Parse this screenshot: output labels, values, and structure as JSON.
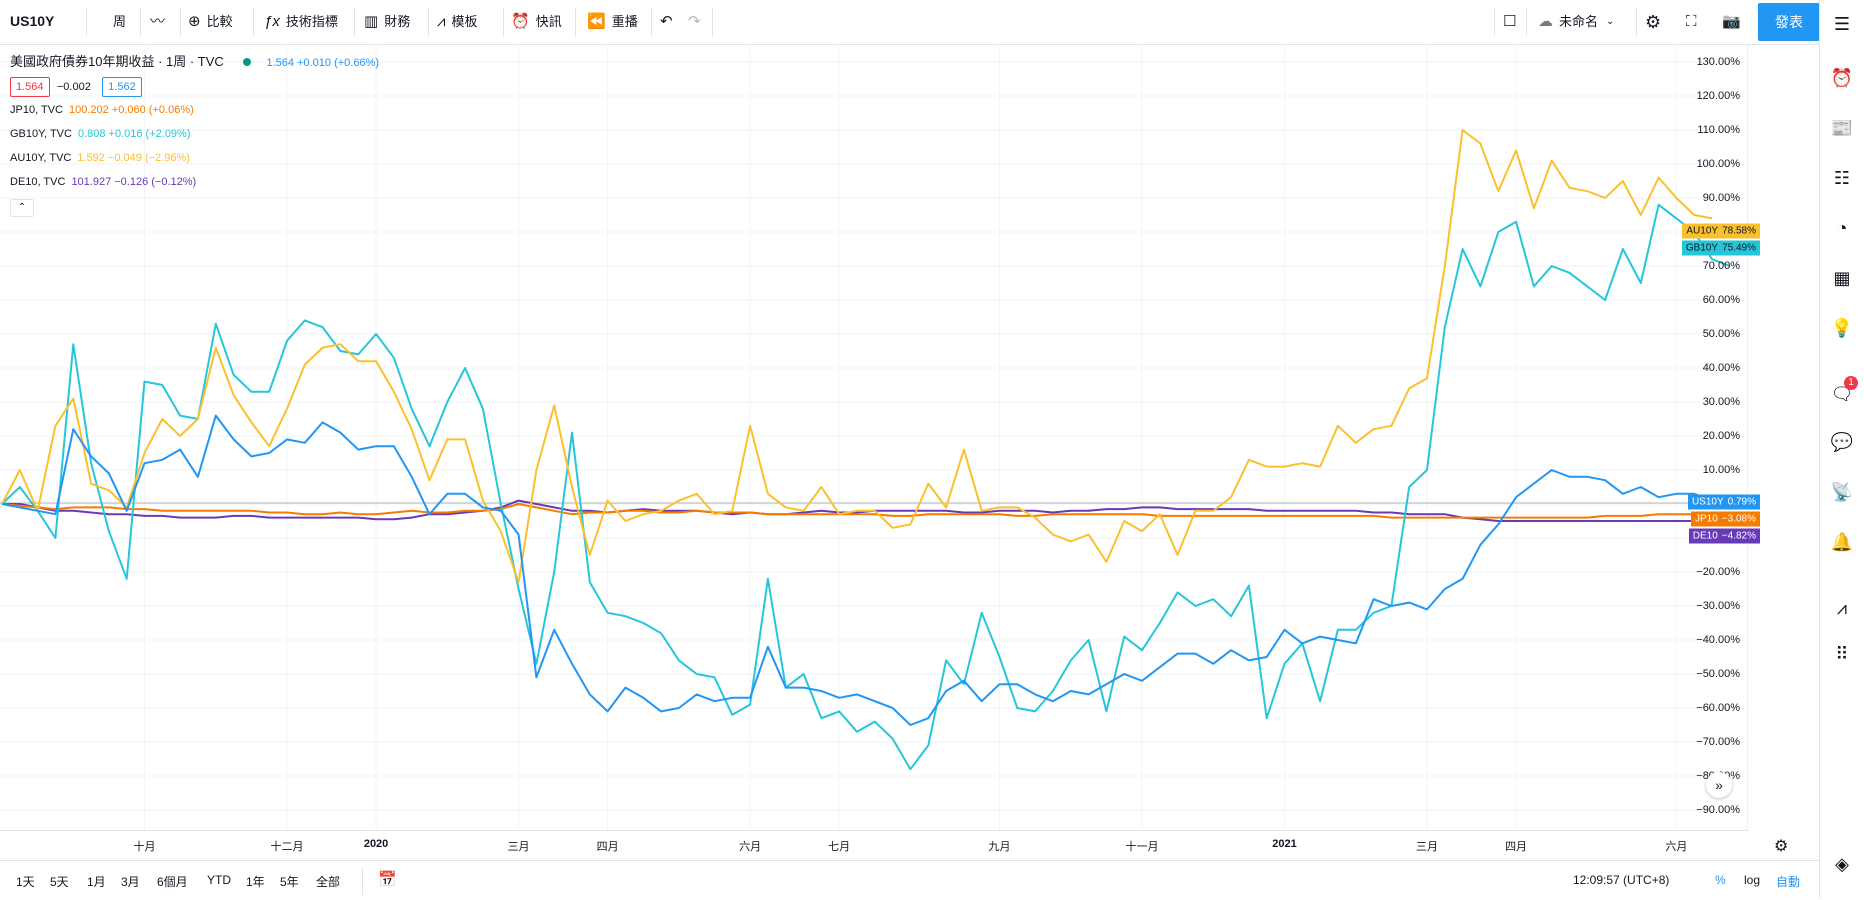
{
  "toolbar": {
    "symbol": "US10Y",
    "interval": "周",
    "compare": "比較",
    "indicators": "技術指標",
    "financials": "財務",
    "templates": "模板",
    "alert": "快訊",
    "replay": "重播",
    "layout_name": "未命名",
    "publish": "發表"
  },
  "legend": {
    "main_title": "美國政府債券10年期收益 · 1周 · TVC",
    "main_value": "1.564 +0.010 (+0.66%)",
    "bid": "1.564",
    "spread": "−0.002",
    "ask": "1.562",
    "items": [
      {
        "name": "JP10, TVC",
        "value": "100.202 +0.060 (+0.06%)",
        "color": "#f57c00"
      },
      {
        "name": "GB10Y, TVC",
        "value": "0.808 +0.016 (+2.09%)",
        "color": "#26c6da"
      },
      {
        "name": "AU10Y, TVC",
        "value": "1.592 −0.049 (−2.96%)",
        "color": "#fbc02d"
      },
      {
        "name": "DE10, TVC",
        "value": "101.927 −0.126 (−0.12%)",
        "color": "#673ab7"
      }
    ]
  },
  "colors": {
    "us10y": "#2196f3",
    "jp10": "#f57c00",
    "gb10y": "#26c6da",
    "au10y": "#fbc02d",
    "de10": "#673ab7"
  },
  "chart_data": {
    "type": "line",
    "y_axis_unit": "percent change",
    "ylim": [
      -95,
      135
    ],
    "y_ticks": [
      "130.00%",
      "120.00%",
      "110.00%",
      "100.00%",
      "90.00%",
      "80.00%",
      "70.00%",
      "60.00%",
      "50.00%",
      "40.00%",
      "30.00%",
      "20.00%",
      "10.00%",
      "0.00%",
      "−10.00%",
      "−20.00%",
      "−30.00%",
      "−40.00%",
      "−50.00%",
      "−60.00%",
      "−70.00%",
      "−80.00%",
      "−90.00%"
    ],
    "y_tick_values": [
      130,
      120,
      110,
      100,
      90,
      80,
      70,
      60,
      50,
      40,
      30,
      20,
      10,
      0,
      -10,
      -20,
      -30,
      -40,
      -50,
      -60,
      -70,
      -80,
      -90
    ],
    "x_labels": [
      "十月",
      "十二月",
      "2020",
      "三月",
      "四月",
      "六月",
      "七月",
      "九月",
      "十一月",
      "2021",
      "三月",
      "四月",
      "六月"
    ],
    "x_label_weeks": [
      8,
      16,
      21,
      29,
      34,
      42,
      47,
      56,
      64,
      72,
      80,
      85,
      94
    ],
    "weeks": 97,
    "series": [
      {
        "name": "US10Y",
        "color": "#2196f3",
        "last_label": "0.79%",
        "values": [
          0,
          -1,
          -2,
          -3,
          22,
          14,
          9,
          -2,
          12,
          13,
          16,
          8,
          26,
          19,
          14,
          15,
          19,
          18,
          24,
          21,
          16,
          17,
          17,
          8,
          -3,
          3,
          3,
          -1,
          -2,
          -9,
          -51,
          -37,
          -47,
          -56,
          -61,
          -54,
          -57,
          -61,
          -60,
          -56,
          -58,
          -57,
          -57,
          -42,
          -54,
          -54,
          -55,
          -57,
          -56,
          -58,
          -60,
          -65,
          -63,
          -55,
          -52,
          -58,
          -53,
          -53,
          -56,
          -58,
          -55,
          -56,
          -53,
          -50,
          -52,
          -48,
          -44,
          -44,
          -47,
          -43,
          -46,
          -45,
          -37,
          -41,
          -39,
          -40,
          -41,
          -28,
          -30,
          -29,
          -31,
          -25,
          -22,
          -12,
          -6,
          2,
          6,
          10,
          8,
          8,
          7,
          3,
          5,
          2,
          3,
          3,
          1,
          2,
          1
        ]
      },
      {
        "name": "JP10",
        "color": "#f57c00",
        "last_label": "−3.08%",
        "values": [
          0,
          -0.5,
          -1,
          -1.5,
          -1,
          -1,
          -1,
          -1.5,
          -1.5,
          -2,
          -2,
          -2,
          -2,
          -2,
          -2,
          -2.5,
          -2.5,
          -3,
          -3,
          -2.5,
          -3,
          -3,
          -2.5,
          -2,
          -2.5,
          -2.5,
          -2,
          -2,
          -1.5,
          0,
          -1,
          -2,
          -3,
          -2.5,
          -2.5,
          -2,
          -2,
          -2.5,
          -2.5,
          -2,
          -2.5,
          -2.5,
          -2.5,
          -3,
          -3,
          -3,
          -3,
          -3,
          -3,
          -3,
          -3.5,
          -3.5,
          -3,
          -3,
          -3,
          -3,
          -3,
          -3.5,
          -3.5,
          -3,
          -3,
          -3,
          -3,
          -3,
          -3,
          -3.5,
          -3.5,
          -3.5,
          -3.5,
          -3.5,
          -3.5,
          -3.5,
          -3.5,
          -3.5,
          -3.5,
          -3.5,
          -3.5,
          -3.5,
          -4,
          -4,
          -4,
          -4,
          -4,
          -4,
          -4,
          -4,
          -4,
          -4,
          -4,
          -4,
          -3.5,
          -3.5,
          -3.5,
          -3,
          -3,
          -3,
          -3,
          -3
        ]
      },
      {
        "name": "GB10Y",
        "color": "#26c6da",
        "last_label": "75.49%",
        "values": [
          0,
          5,
          -2,
          -10,
          47,
          12,
          -8,
          -22,
          36,
          35,
          26,
          25,
          53,
          38,
          33,
          33,
          48,
          54,
          52,
          45,
          44,
          50,
          43,
          28,
          17,
          30,
          40,
          28,
          0,
          -25,
          -47,
          -20,
          21,
          -23,
          -32,
          -33,
          -35,
          -38,
          -46,
          -50,
          -51,
          -62,
          -59,
          -22,
          -54,
          -50,
          -63,
          -61,
          -67,
          -64,
          -69,
          -78,
          -71,
          -46,
          -53,
          -32,
          -45,
          -60,
          -61,
          -55,
          -46,
          -40,
          -61,
          -39,
          -43,
          -35,
          -26,
          -30,
          -28,
          -33,
          -24,
          -63,
          -47,
          -41,
          -58,
          -37,
          -37,
          -32,
          -30,
          5,
          10,
          52,
          75,
          64,
          80,
          83,
          64,
          70,
          68,
          64,
          60,
          75,
          65,
          88,
          84,
          80,
          72,
          70
        ]
      },
      {
        "name": "AU10Y",
        "color": "#fbc02d",
        "last_label": "78.58%",
        "values": [
          0,
          10,
          -2,
          23,
          31,
          6,
          4,
          -1,
          15,
          25,
          20,
          25,
          46,
          32,
          24,
          17,
          28,
          41,
          46,
          47,
          42,
          42,
          33,
          22,
          7,
          19,
          19,
          1,
          -8,
          -23,
          10,
          29,
          5,
          -15,
          1,
          -5,
          -3,
          -2,
          1,
          3,
          -3,
          -2,
          23,
          3,
          -1,
          -2,
          5,
          -3,
          -2,
          -2,
          -7,
          -6,
          6,
          -1,
          16,
          -2,
          -1,
          -1,
          -4,
          -9,
          -11,
          -9,
          -17,
          -5,
          -8,
          -3,
          -15,
          -2,
          -2,
          2,
          13,
          11,
          11,
          12,
          11,
          23,
          18,
          22,
          23,
          34,
          37,
          70,
          110,
          106,
          92,
          104,
          87,
          101,
          93,
          92,
          90,
          95,
          85,
          96,
          90,
          85,
          84
        ]
      },
      {
        "name": "DE10",
        "color": "#673ab7",
        "last_label": "−4.82%",
        "values": [
          0,
          0,
          -1,
          -2,
          -2,
          -2.5,
          -3,
          -3,
          -3.5,
          -3.5,
          -4,
          -4,
          -4,
          -3.5,
          -3.5,
          -4,
          -4,
          -4,
          -4,
          -4,
          -4,
          -4.5,
          -4.5,
          -4,
          -3,
          -3,
          -2.5,
          -2,
          -1,
          1,
          0,
          -1,
          -2,
          -2,
          -2.5,
          -2,
          -1.5,
          -2,
          -2,
          -2,
          -2.5,
          -3,
          -2.5,
          -3,
          -3,
          -2.5,
          -2,
          -2.5,
          -2.5,
          -2,
          -2,
          -2,
          -2,
          -2,
          -2.5,
          -2.5,
          -2,
          -2,
          -2,
          -2.5,
          -2,
          -2,
          -1.5,
          -1.5,
          -1,
          -1,
          -1.5,
          -1.5,
          -1.5,
          -1.5,
          -1.5,
          -2,
          -2,
          -2,
          -2,
          -2,
          -2,
          -2.5,
          -2.5,
          -3,
          -3,
          -3,
          -4,
          -4.5,
          -5,
          -5,
          -5,
          -5,
          -5,
          -5,
          -5,
          -5,
          -5,
          -5,
          -5,
          -5,
          -5,
          -5
        ]
      }
    ]
  },
  "time_range": {
    "items": [
      "1天",
      "5天",
      "1月",
      "3月",
      "6個月",
      "YTD",
      "1年",
      "5年",
      "全部"
    ],
    "clock": "12:09:57 (UTC+8)",
    "percent": "%",
    "log": "log",
    "auto": "自動"
  }
}
